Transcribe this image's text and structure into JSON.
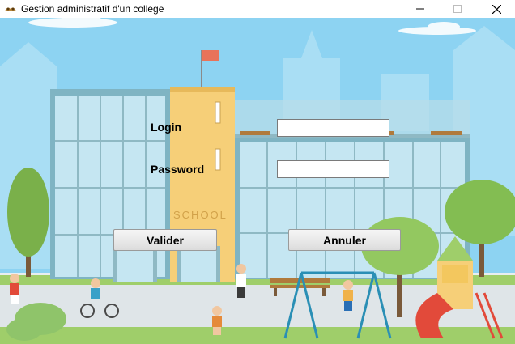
{
  "window": {
    "title": "Gestion administratif d'un college",
    "app_icon": "app-logo-icon",
    "controls": {
      "minimize": "minimize-icon",
      "maximize": "maximize-icon",
      "close": "close-icon"
    }
  },
  "scene": {
    "school_sign": "SCHOOL"
  },
  "form": {
    "login_label": "Login",
    "login_value": "",
    "password_label": "Password",
    "password_value": "",
    "valider_label": "Valider",
    "annuler_label": "Annuler"
  },
  "colors": {
    "sky": "#8dd3f2",
    "ground": "#e9eef0",
    "grass": "#9fce6a",
    "tower": "#f6cf78",
    "glass": "#c5e6f2",
    "frame": "#8fb9c4"
  }
}
